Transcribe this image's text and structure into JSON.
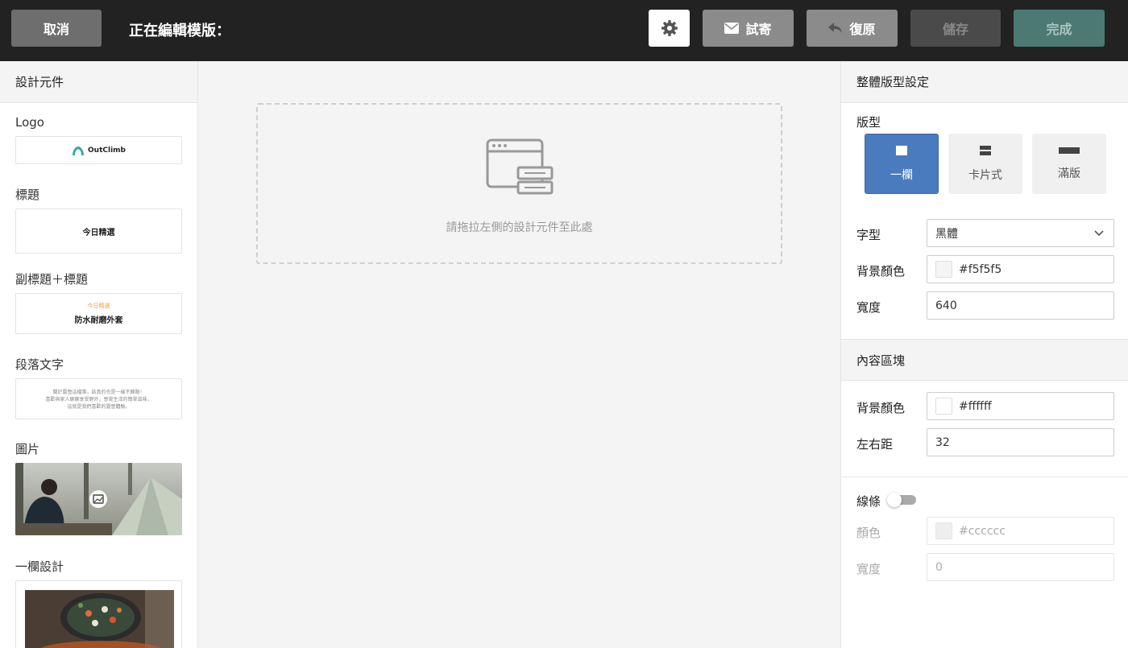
{
  "topbar": {
    "cancel_label": "取消",
    "editing_title": "正在編輯模版：",
    "settings_icon": "gear-icon",
    "test_send_label": "試寄",
    "undo_label": "復原",
    "save_label": "儲存",
    "done_label": "完成"
  },
  "left_panel": {
    "title": "設計元件",
    "components": [
      {
        "label": "Logo",
        "preview_text": "OutClimb"
      },
      {
        "label": "標題",
        "preview_text": "今日精選"
      },
      {
        "label": "副標題＋標題",
        "preview_sub": "今日精選",
        "preview_text": "防水耐磨外套"
      },
      {
        "label": "段落文字",
        "preview_lines": [
          "關於露營這檔事，該真的也是一樣不歸路！",
          "喜歡與家人聊聊享受野外，感覺生活的簡單滋味，",
          "這就是我們喜歡的露營體驗。"
        ]
      },
      {
        "label": "圖片"
      },
      {
        "label": "一欄設計"
      }
    ]
  },
  "canvas": {
    "placeholder": "請拖拉左側的設計元件至此處"
  },
  "right_panel": {
    "global_title": "整體版型設定",
    "layout_label": "版型",
    "layout_options": [
      {
        "label": "一欄",
        "active": true
      },
      {
        "label": "卡片式",
        "active": false
      },
      {
        "label": "滿版",
        "active": false
      }
    ],
    "font_label": "字型",
    "font_value": "黑體",
    "bg_color_label": "背景顏色",
    "bg_color_value": "#f5f5f5",
    "width_label": "寬度",
    "width_value": "640",
    "content_title": "內容區塊",
    "content_bg_label": "背景顏色",
    "content_bg_value": "#ffffff",
    "padding_label": "左右距",
    "padding_value": "32",
    "line_label": "線條",
    "line_enabled": false,
    "line_color_label": "顏色",
    "line_color_value": "#cccccc",
    "line_width_label": "寬度",
    "line_width_value": "0"
  },
  "colors": {
    "topbar_bg": "#222222",
    "accent_blue": "#4a7bbf",
    "done_green": "#4c7a72"
  }
}
